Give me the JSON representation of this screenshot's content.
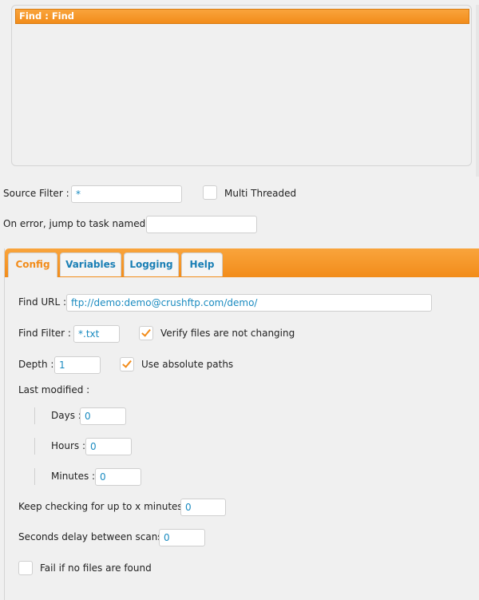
{
  "task_list": {
    "items": [
      "Find : Find"
    ]
  },
  "source_filter": {
    "label": "Source Filter :",
    "value": "*"
  },
  "multi_threaded": {
    "label": "Multi Threaded",
    "checked": false
  },
  "on_error": {
    "label": "On error, jump to task named :",
    "value": ""
  },
  "tabs": [
    "Config",
    "Variables",
    "Logging",
    "Help"
  ],
  "config": {
    "find_url": {
      "label": "Find URL :",
      "value": "ftp://demo:demo@crushftp.com/demo/"
    },
    "find_filter": {
      "label": "Find Filter :",
      "value": "*.txt"
    },
    "verify": {
      "label": "Verify files are not changing",
      "checked": true
    },
    "depth": {
      "label": "Depth :",
      "value": "1"
    },
    "absolute": {
      "label": "Use absolute paths",
      "checked": true
    },
    "last_modified": {
      "label": "Last modified :"
    },
    "days": {
      "label": "Days :",
      "value": "0"
    },
    "hours": {
      "label": "Hours :",
      "value": "0"
    },
    "minutes": {
      "label": "Minutes :",
      "value": "0"
    },
    "keep_checking": {
      "label": "Keep checking for up to x minutes :",
      "value": "0"
    },
    "seconds_delay": {
      "label": "Seconds delay between scans :",
      "value": "0"
    },
    "fail_if_none": {
      "label": "Fail if no files are found",
      "checked": false
    }
  },
  "colors": {
    "accent": "#f28c1a",
    "link": "#1a7fb5"
  }
}
